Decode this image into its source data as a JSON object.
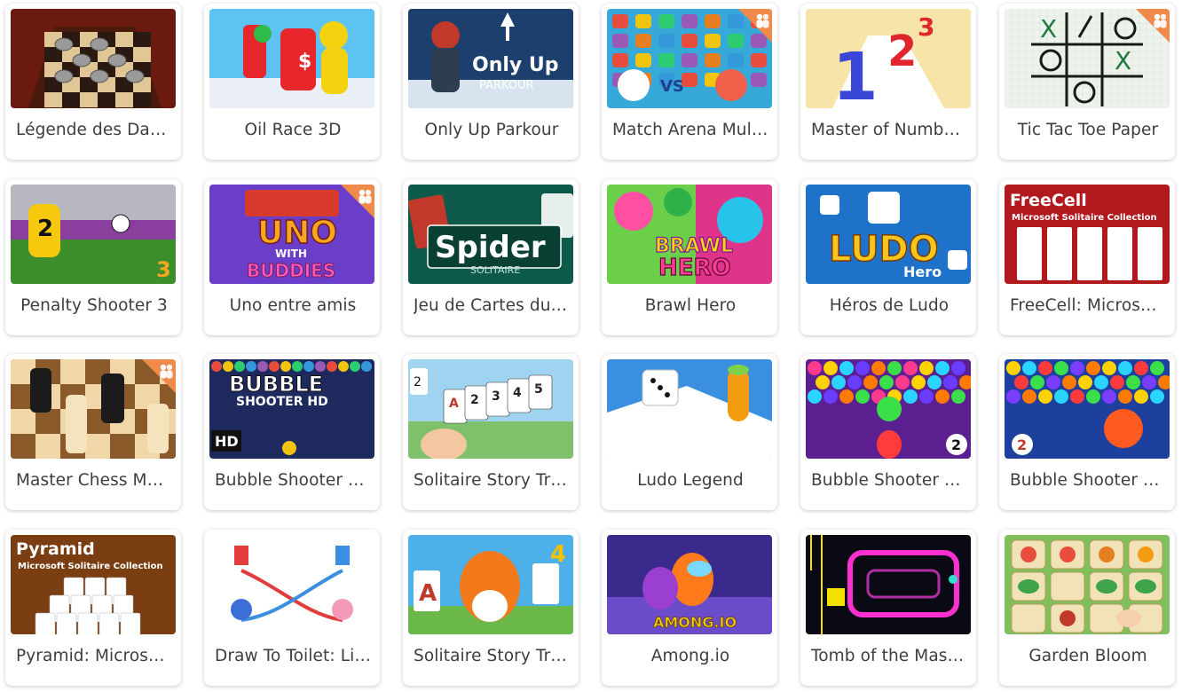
{
  "multiplayer_badge_icon": "multiplayer-people-icon",
  "games": [
    {
      "title": "Légende des Dam…",
      "slug": "legende-des-dames",
      "thumb_text": "",
      "multiplayer": false,
      "colors": [
        "#6b1a10",
        "#e2c796"
      ]
    },
    {
      "title": "Oil Race 3D",
      "slug": "oil-race-3d",
      "thumb_text": "",
      "multiplayer": false,
      "colors": [
        "#5cc3f2",
        "#e8272c"
      ]
    },
    {
      "title": "Only Up Parkour",
      "slug": "only-up-parkour",
      "thumb_text": "Only Up\nPARKOUR",
      "multiplayer": false,
      "colors": [
        "#1c3f6e",
        "#ffffff"
      ]
    },
    {
      "title": "Match Arena Mult…",
      "slug": "match-arena-multiplayer",
      "thumb_text": "VS",
      "multiplayer": true,
      "colors": [
        "#37a9d8",
        "#f0604a"
      ]
    },
    {
      "title": "Master of Numbe…",
      "slug": "master-of-numbers",
      "thumb_text": "1 2 3",
      "multiplayer": false,
      "colors": [
        "#f6e4a8",
        "#3b47d6"
      ]
    },
    {
      "title": "Tic Tac Toe Paper",
      "slug": "tic-tac-toe-paper",
      "thumb_text": "X / O",
      "multiplayer": true,
      "colors": [
        "#eef3ee",
        "#1a1a1a"
      ]
    },
    {
      "title": "Penalty Shooter 3",
      "slug": "penalty-shooter-3",
      "thumb_text": "2",
      "multiplayer": false,
      "colors": [
        "#3c8e2c",
        "#f6c90e"
      ]
    },
    {
      "title": "Uno entre amis",
      "slug": "uno-entre-amis",
      "thumb_text": "UNO\nWITH\nBUDDIES",
      "multiplayer": true,
      "colors": [
        "#6a3ec9",
        "#f5a623"
      ]
    },
    {
      "title": "Jeu de Cartes du …",
      "slug": "jeu-de-cartes-spider",
      "thumb_text": "Spider\nSOLITAIRE",
      "multiplayer": false,
      "colors": [
        "#0d5a4a",
        "#ffffff"
      ]
    },
    {
      "title": "Brawl Hero",
      "slug": "brawl-hero",
      "thumb_text": "BRAWL\nHERO",
      "multiplayer": false,
      "colors": [
        "#e0338a",
        "#2fb14a"
      ]
    },
    {
      "title": "Héros de Ludo",
      "slug": "heros-de-ludo",
      "thumb_text": "LUDO\nHero",
      "multiplayer": false,
      "colors": [
        "#1f72c9",
        "#f7c51e"
      ]
    },
    {
      "title": "FreeCell: Microsof…",
      "slug": "freecell-microsoft",
      "thumb_text": "FreeCell\nMicrosoft Solitaire Collection",
      "multiplayer": false,
      "colors": [
        "#b01a1f",
        "#ffffff"
      ]
    },
    {
      "title": "Master Chess Mul…",
      "slug": "master-chess-multiplayer",
      "thumb_text": "",
      "multiplayer": true,
      "colors": [
        "#6b3d1a",
        "#f1d7a8"
      ]
    },
    {
      "title": "Bubble Shooter HD",
      "slug": "bubble-shooter-hd",
      "thumb_text": "BUBBLE\nSHOOTER HD\nHD",
      "multiplayer": false,
      "colors": [
        "#1e2a5e",
        "#ffffff"
      ]
    },
    {
      "title": "Solitaire Story Tri…",
      "slug": "solitaire-story-tripeaks",
      "thumb_text": "A 2 3 4 5",
      "multiplayer": false,
      "colors": [
        "#9fd3ef",
        "#ffffff"
      ]
    },
    {
      "title": "Ludo Legend",
      "slug": "ludo-legend",
      "thumb_text": "",
      "multiplayer": false,
      "colors": [
        "#3a8fe0",
        "#ffffff"
      ]
    },
    {
      "title": "Bubble Shooter P…",
      "slug": "bubble-shooter-pro-2",
      "thumb_text": "2",
      "multiplayer": false,
      "colors": [
        "#5b1f8f",
        "#ff3b3b"
      ]
    },
    {
      "title": "Bubble Shooter F…",
      "slug": "bubble-shooter-free-2",
      "thumb_text": "2",
      "multiplayer": false,
      "colors": [
        "#1d3f9e",
        "#ff5a1f"
      ]
    },
    {
      "title": "Pyramid: Microso…",
      "slug": "pyramid-microsoft",
      "thumb_text": "Pyramid\nMicrosoft Solitaire Collection",
      "multiplayer": false,
      "colors": [
        "#7a3e12",
        "#ffffff"
      ]
    },
    {
      "title": "Draw To Toilet: Li…",
      "slug": "draw-to-toilet",
      "thumb_text": "",
      "multiplayer": false,
      "colors": [
        "#ffffff",
        "#e13b3b"
      ]
    },
    {
      "title": "Solitaire Story Tri…",
      "slug": "solitaire-story-tripeaks-4",
      "thumb_text": "A\n4",
      "multiplayer": false,
      "colors": [
        "#4db0e8",
        "#f27a1a"
      ]
    },
    {
      "title": "Among.io",
      "slug": "among-io",
      "thumb_text": "AMONG.IO",
      "multiplayer": false,
      "colors": [
        "#3a2a8c",
        "#ff7a1a"
      ]
    },
    {
      "title": "Tomb of the Mask…",
      "slug": "tomb-of-the-mask",
      "thumb_text": "",
      "multiplayer": false,
      "colors": [
        "#0a0a14",
        "#ff2fd1"
      ]
    },
    {
      "title": "Garden Bloom",
      "slug": "garden-bloom",
      "thumb_text": "",
      "multiplayer": false,
      "colors": [
        "#7fbf5c",
        "#f2e2b8"
      ]
    }
  ]
}
